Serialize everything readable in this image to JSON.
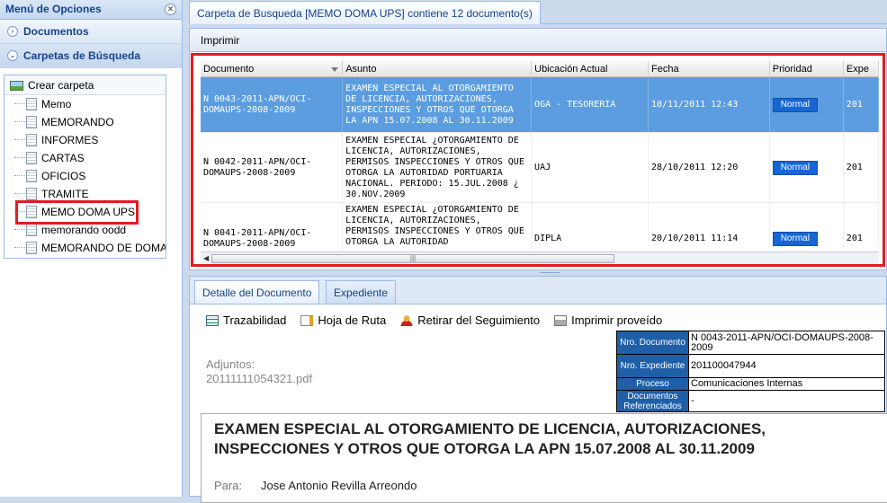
{
  "left_panel": {
    "title": "Menú de Opciones",
    "sections": [
      {
        "label": "Documentos"
      },
      {
        "label": "Carpetas de Búsqueda"
      }
    ],
    "create_folder_label": "Crear carpeta",
    "folders": [
      "Memo",
      "MEMORANDO",
      "INFORMES",
      "CARTAS",
      "OFICIOS",
      "TRAMITE",
      "MEMO DOMA UPS",
      "memorando oodd",
      "MEMORANDO DE DOMA"
    ]
  },
  "main": {
    "tab_label": "Carpeta de Busqueda [MEMO DOMA UPS] contiene 12 documento(s)",
    "print_label": "Imprimir",
    "columns": [
      "Documento",
      "Asunto",
      "Ubicación Actual",
      "Fecha",
      "Prioridad",
      "Expe"
    ],
    "rows": [
      {
        "documento": "N 0043-2011-APN/OCI-DOMAUPS-2008-2009",
        "asunto": "EXAMEN ESPECIAL AL OTORGAMIENTO DE LICENCIA, AUTORIZACIONES, INSPECCIONES Y OTROS QUE OTORGA LA APN 15.07.2008 AL 30.11.2009",
        "ubicacion": "OGA - TESORERIA",
        "fecha": "10/11/2011 12:43",
        "prioridad": "Normal",
        "expediente": "201"
      },
      {
        "documento": "N 0042-2011-APN/OCI-DOMAUPS-2008-2009",
        "asunto": "EXAMEN ESPECIAL ¿OTORGAMIENTO DE LICENCIA, AUTORIZACIONES, PERMISOS INSPECCIONES Y OTROS QUE OTORGA LA AUTORIDAD PORTUARIA NACIONAL. PERIODO: 15.JUL.2008 ¿ 30.NOV.2009",
        "ubicacion": "UAJ",
        "fecha": "28/10/2011 12:20",
        "prioridad": "Normal",
        "expediente": "201"
      },
      {
        "documento": "N 0041-2011-APN/OCI-DOMAUPS-2008-2009",
        "asunto": "EXAMEN ESPECIAL ¿OTORGAMIENTO DE LICENCIA, AUTORIZACIONES, PERMISOS INSPECCIONES Y OTROS QUE OTORGA LA AUTORIDAD",
        "ubicacion": "DIPLA",
        "fecha": "20/10/2011 11:14",
        "prioridad": "Normal",
        "expediente": "201"
      }
    ]
  },
  "detail": {
    "tabs": [
      "Detalle del Documento",
      "Expediente"
    ],
    "toolbar": [
      "Trazabilidad",
      "Hoja de Ruta",
      "Retirar del Seguimiento",
      "Imprimir proveído"
    ],
    "adjuntos_label": "Adjuntos:",
    "adjuntos_file": "20111111054321.pdf",
    "meta": [
      {
        "label": "Nro. Documento",
        "value": "N 0043-2011-APN/OCI-DOMAUPS-2008-2009"
      },
      {
        "label": "Nro. Expediente",
        "value": "201100047944"
      },
      {
        "label": "Proceso",
        "value": "Comunicaciones Internas"
      },
      {
        "label": "Documentos Referenciados",
        "value": "-"
      }
    ],
    "doc_title": "EXAMEN ESPECIAL AL OTORGAMIENTO DE LICENCIA, AUTORIZACIONES, INSPECCIONES Y OTROS QUE OTORGA LA APN 15.07.2008 AL 30.11.2009",
    "para_label": "Para:",
    "para_value": "Jose Antonio Revilla Arreondo"
  },
  "colors": {
    "selected_row": "#5c9de0",
    "priority_badge": "#1666d4",
    "highlight": "#e21b23",
    "header_text": "#15428b"
  }
}
